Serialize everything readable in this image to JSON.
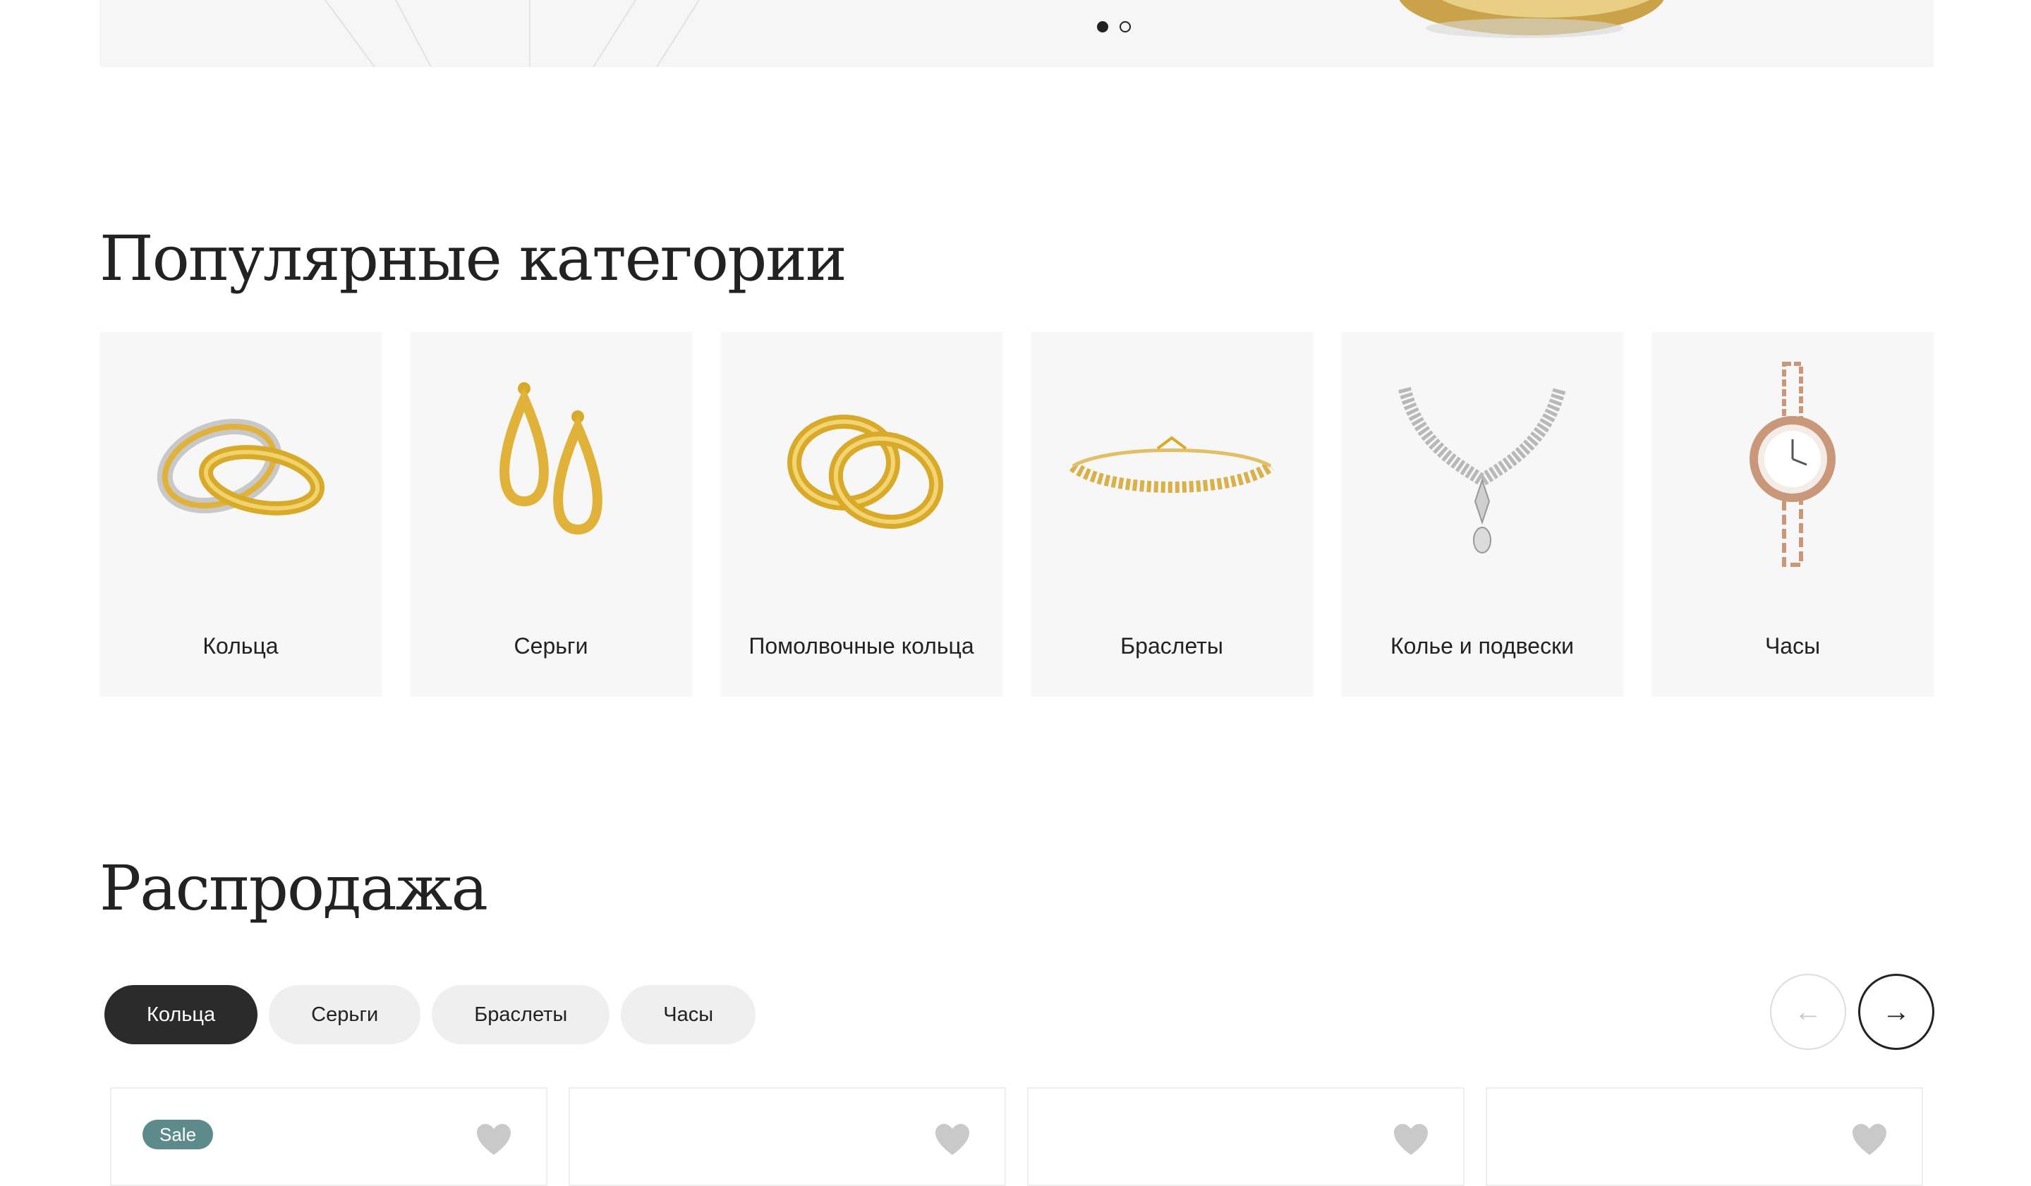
{
  "hero": {
    "slides_total": 2,
    "active_slide": 1
  },
  "categories_section": {
    "title": "Популярные категории",
    "items": [
      {
        "label": "Кольца",
        "icon": "rings-icon"
      },
      {
        "label": "Серьги",
        "icon": "earrings-icon"
      },
      {
        "label": "Помолвочные кольца",
        "icon": "engagement-rings-icon"
      },
      {
        "label": "Браслеты",
        "icon": "bracelet-icon"
      },
      {
        "label": "Колье и подвески",
        "icon": "necklace-icon"
      },
      {
        "label": "Часы",
        "icon": "watch-icon"
      }
    ]
  },
  "sale_section": {
    "title": "Распродажа",
    "tabs": [
      {
        "label": "Кольца",
        "active": true
      },
      {
        "label": "Серьги",
        "active": false
      },
      {
        "label": "Браслеты",
        "active": false
      },
      {
        "label": "Часы",
        "active": false
      }
    ],
    "prev_arrow": "←",
    "next_arrow": "→",
    "products": [
      {
        "badge": "Sale"
      },
      {
        "badge": ""
      },
      {
        "badge": ""
      },
      {
        "badge": ""
      }
    ]
  },
  "colors": {
    "accent_dark": "#2b2b2b",
    "sale_badge": "#5d8a8b",
    "gold": "#d4a72c"
  }
}
